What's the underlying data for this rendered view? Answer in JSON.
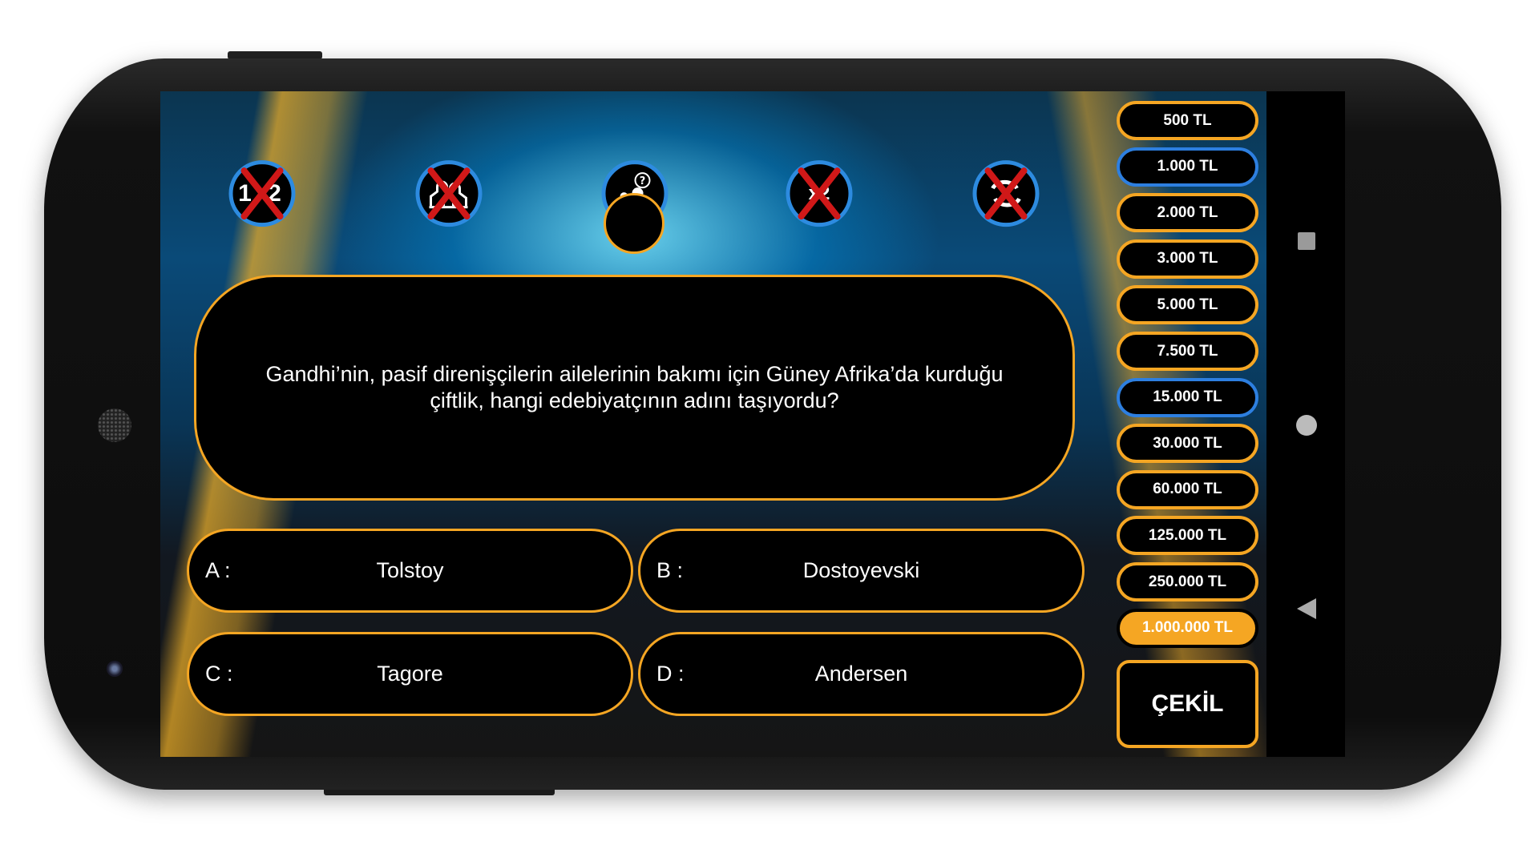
{
  "lifelines": [
    {
      "name": "fifty-fifty",
      "label": "1 2",
      "used": true
    },
    {
      "name": "ask-audience",
      "used": true
    },
    {
      "name": "phone-friend",
      "used": false
    },
    {
      "name": "double-answer",
      "used": true
    },
    {
      "name": "change-question",
      "used": true
    }
  ],
  "question": "Gandhi’nin, pasif direnişçilerin ailelerinin bakımı için Güney Afrika’da kurduğu çiftlik, hangi edebiyatçının adını taşıyordu?",
  "answers": [
    {
      "letter": "A :",
      "text": "Tolstoy"
    },
    {
      "letter": "B :",
      "text": "Dostoyevski"
    },
    {
      "letter": "C :",
      "text": "Tagore"
    },
    {
      "letter": "D :",
      "text": "Andersen"
    }
  ],
  "prize_ladder": [
    {
      "label": "500 TL",
      "state": "normal"
    },
    {
      "label": "1.000 TL",
      "state": "safe"
    },
    {
      "label": "2.000 TL",
      "state": "normal"
    },
    {
      "label": "3.000 TL",
      "state": "normal"
    },
    {
      "label": "5.000 TL",
      "state": "normal"
    },
    {
      "label": "7.500 TL",
      "state": "normal"
    },
    {
      "label": "15.000 TL",
      "state": "safe"
    },
    {
      "label": "30.000 TL",
      "state": "normal"
    },
    {
      "label": "60.000 TL",
      "state": "normal"
    },
    {
      "label": "125.000 TL",
      "state": "normal"
    },
    {
      "label": "250.000 TL",
      "state": "normal"
    },
    {
      "label": "1.000.000 TL",
      "state": "current"
    }
  ],
  "withdraw_label": "ÇEKİL",
  "colors": {
    "accent": "#f5a623",
    "safe": "#2d7fe0",
    "lifeline_ring": "#2d8be0",
    "used_x": "#d01818"
  },
  "nav": [
    "recents-square-icon",
    "home-circle-icon",
    "back-triangle-icon"
  ]
}
